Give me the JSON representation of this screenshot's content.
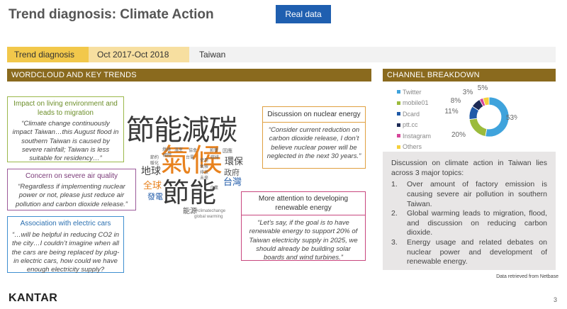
{
  "header": {
    "title": "Trend diagnosis: Climate Action",
    "real_data_label": "Real data"
  },
  "filter_bar": {
    "section": "Trend diagnosis",
    "period": "Oct 2017-Oct 2018",
    "region": "Taiwan"
  },
  "sections": {
    "wordcloud_title": "WORDCLOUD AND KEY TRENDS",
    "channel_title": "CHANNEL BREAKDOWN"
  },
  "callouts": {
    "living": {
      "title": "Impact on living environment and leads to migration",
      "quote": "“Climate change continuously impact Taiwan…this August flood in southern Taiwan is caused by severe rainfall; Taiwan is less suitable for residency…”"
    },
    "air": {
      "title": "Concern on severe air quality",
      "quote": "“Regardless if implementing nuclear power or not, please just reduce air pollution and carbon dioxide release.”"
    },
    "cars": {
      "title": "Association with electric cars",
      "quote": "“…will be helpful in reducing CO2 in the city…I couldn’t imagine when all the cars are being replaced by plug-in electric cars, how could we have enough electricity supply?"
    },
    "nuclear": {
      "title": "Discussion on nuclear energy",
      "quote": "“Consider current reduction on carbon dioxide release, I don’t believe nuclear power will be neglected in the next 30 years.”"
    },
    "renewable": {
      "title": "More attention to developing renewable energy",
      "quote": "“Let’s say, if the goal is to have renewable energy to support 20% of Taiwan electricity supply in 2025, we should already be building solar boards and wind turbines.”"
    }
  },
  "wordcloud": {
    "words": {
      "w1": "節能減碳",
      "w2": "氣候",
      "w3": "節能",
      "w4": "地球",
      "w5": "全球",
      "w6": "環保",
      "w7": "政府",
      "w8": "台灣",
      "w9": "發電",
      "w10": "能源",
      "w11": "#climatechange",
      "w12": "global warming",
      "w13": "燃燒",
      "w14": "溫室",
      "w15": "協會",
      "w16": "節約",
      "w17": "暖化",
      "w18": "使用",
      "w19": "影響",
      "w20": "因應",
      "w21": "碳排",
      "w22": "氣候",
      "w23": "排放",
      "w24": "未來",
      "w25": "國際",
      "w26": "台電",
      "w27": "企業"
    }
  },
  "chart_data": {
    "type": "pie",
    "title": "",
    "series": [
      {
        "name": "Twitter",
        "value": 53,
        "color": "#3fa3dc"
      },
      {
        "name": "mobile01",
        "value": 20,
        "color": "#9bbb3c"
      },
      {
        "name": "Dcard",
        "value": 11,
        "color": "#1f5aa8"
      },
      {
        "name": "ptt.cc",
        "value": 8,
        "color": "#1c2a55"
      },
      {
        "name": "Instagram",
        "value": 3,
        "color": "#d6469a"
      },
      {
        "name": "Others",
        "value": 5,
        "color": "#f5d03c"
      }
    ],
    "labels": [
      "53%",
      "20%",
      "11%",
      "8%",
      "3%",
      "5%"
    ],
    "legend_position": "left"
  },
  "summary": {
    "intro": "Discussion on climate action in Taiwan lies across 3 major topics:",
    "items": [
      {
        "n": "1.",
        "text": "Over amount of factory emission is causing severe air pollution in southern Taiwan."
      },
      {
        "n": "2.",
        "text": "Global warming leads to migration, flood, and discussion on reducing carbon dioxide."
      },
      {
        "n": "3.",
        "text": "Energy usage and related debates on nuclear power and development of renewable energy."
      }
    ]
  },
  "footer": {
    "source": "Data retrieved from Netbase",
    "logo": "KANTAR",
    "page": "3"
  }
}
